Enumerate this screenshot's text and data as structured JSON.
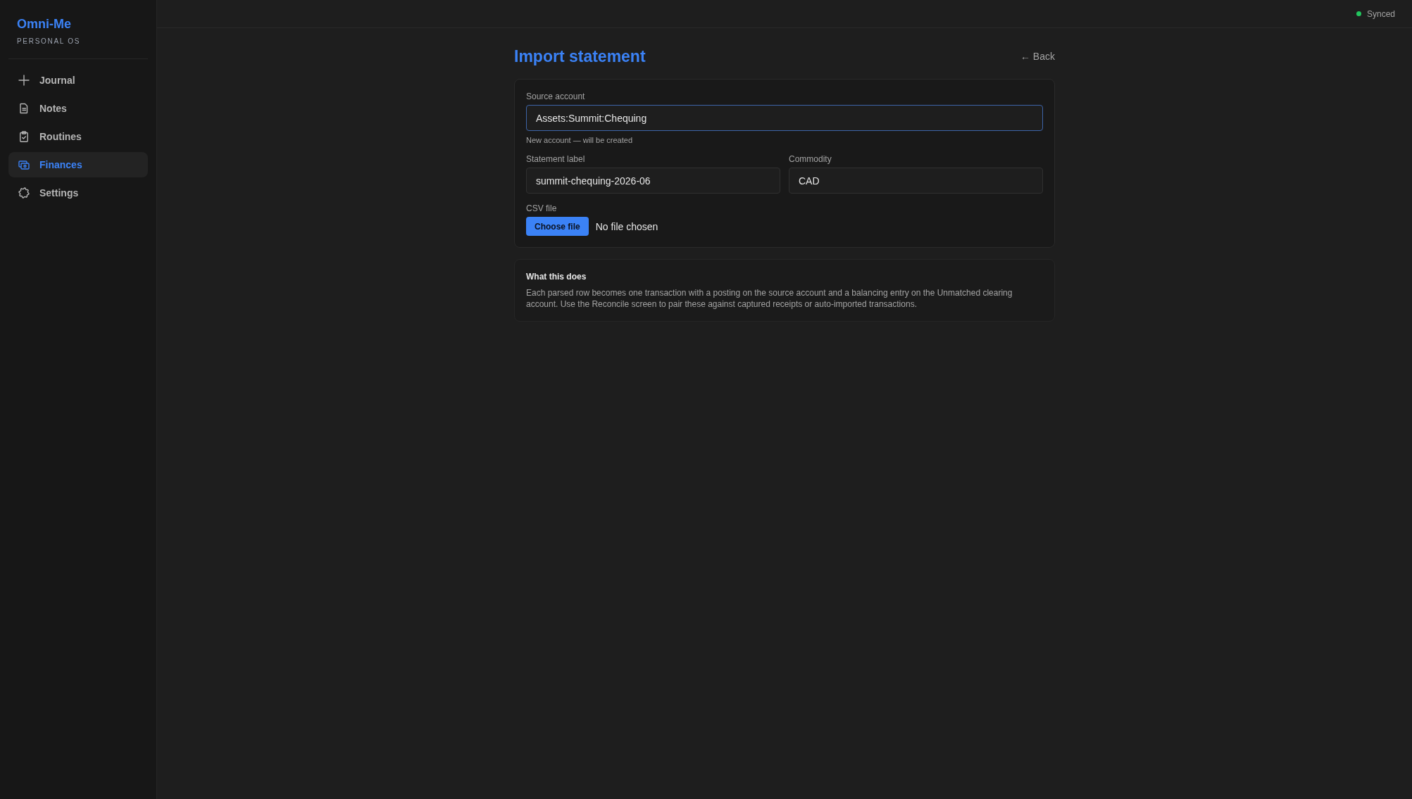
{
  "sidebar": {
    "app_name": "Omni-Me",
    "tagline": "PERSONAL OS",
    "items": [
      {
        "label": "Journal",
        "selected": false
      },
      {
        "label": "Notes",
        "selected": false
      },
      {
        "label": "Routines",
        "selected": false
      },
      {
        "label": "Finances",
        "selected": true
      },
      {
        "label": "Settings",
        "selected": false
      }
    ]
  },
  "header": {
    "sync_status": {
      "label": "Synced",
      "online": true
    }
  },
  "page": {
    "title": "Import statement",
    "back_link": "← Back"
  },
  "import_form": {
    "rows": [
      {
        "fields": [
          {
            "label": "Source account",
            "value": "Assets:Summit:Chequing",
            "focused": true,
            "hint": "New account — will be created"
          }
        ]
      },
      {
        "fields": [
          {
            "label": "Statement label",
            "value": "summit-chequing-2026-06",
            "focused": false
          },
          {
            "label": "Commodity",
            "value": "CAD",
            "focused": false
          }
        ]
      }
    ],
    "file": {
      "label": "CSV file",
      "button": "Choose file",
      "status": "No file chosen"
    }
  },
  "info_card": {
    "title": "What this does",
    "text": "Each parsed row becomes one transaction with a posting on the source account and a balancing entry on the Unmatched clearing account. Use the Reconcile screen to pair these against captured receipts or auto-imported transactions."
  }
}
